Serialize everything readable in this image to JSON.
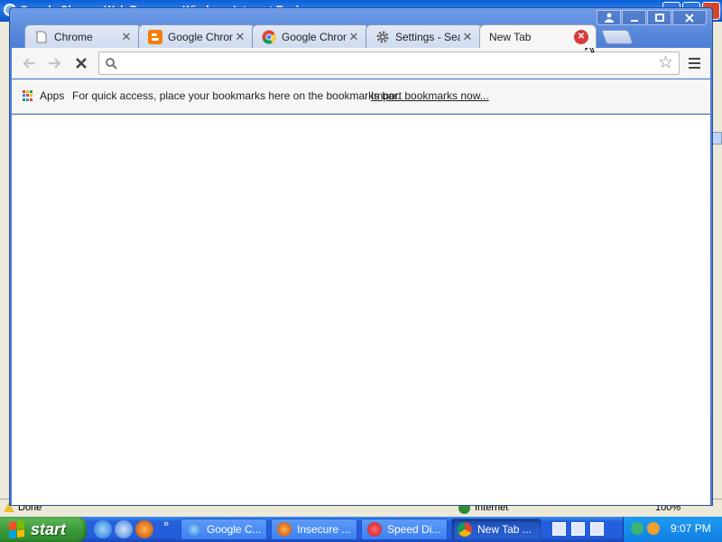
{
  "background_window": {
    "title": "Google Chrome Web Browser - Windows Internet Explorer",
    "status_left": "Done",
    "status_zone": "Internet",
    "status_zoom": "100%"
  },
  "chrome": {
    "tabs": [
      {
        "title": "Chrome",
        "icon": "page-icon",
        "active": false
      },
      {
        "title": "Google Chrome",
        "icon": "blogger-icon",
        "active": false
      },
      {
        "title": "Google Chrome",
        "icon": "chrome-icon",
        "active": false
      },
      {
        "title": "Settings - Search",
        "icon": "gear-icon",
        "active": false
      },
      {
        "title": "New Tab",
        "icon": "none",
        "active": true
      }
    ],
    "tab_close_glyph": "✕",
    "omnibox": {
      "value": "",
      "placeholder": ""
    },
    "bookmarks_bar": {
      "apps_label": "Apps",
      "hint": "For quick access, place your bookmarks here on the bookmarks bar.",
      "import_link": "Import bookmarks now..."
    }
  },
  "taskbar": {
    "start_label": "start",
    "tasks": [
      {
        "label": "Google C...",
        "icon": "ie-icon",
        "active": false
      },
      {
        "label": "Insecure ...",
        "icon": "firefox-icon",
        "active": false
      },
      {
        "label": "Speed Di...",
        "icon": "opera-icon",
        "active": false
      },
      {
        "label": "New Tab ...",
        "icon": "chrome-icon",
        "active": true
      }
    ],
    "quicklaunch_more": "»",
    "clock": "9:07 PM"
  },
  "colors": {
    "chrome_frame": "#4f7fd6",
    "xp_taskbar": "#245edb",
    "start_green": "#3c9b3a",
    "tab_close_hover": "#d83b3b"
  }
}
